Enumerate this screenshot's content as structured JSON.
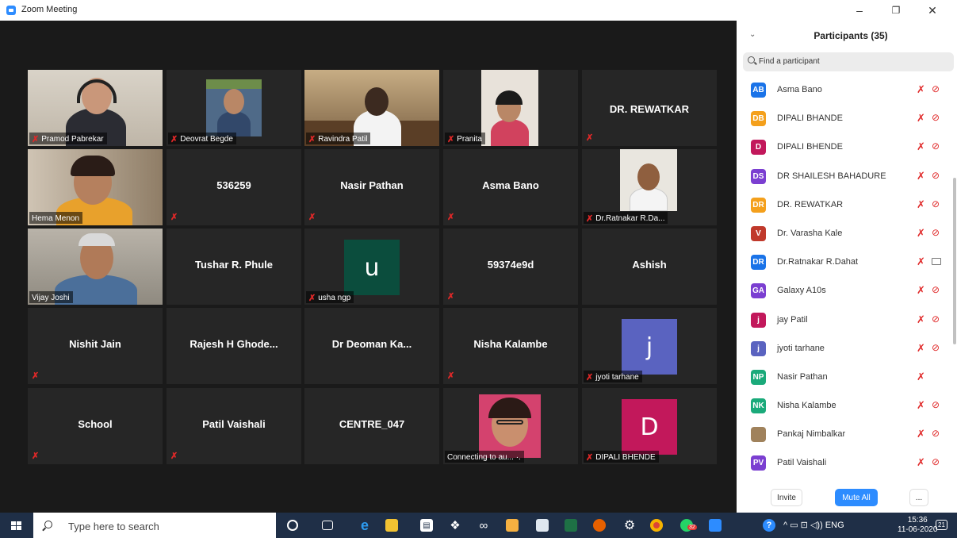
{
  "window": {
    "title": "Zoom Meeting",
    "minimize": "–",
    "restore": "❐",
    "close": "✕"
  },
  "gallery": {
    "mute_glyph": "✗",
    "tiles": [
      {
        "name": "Pramod Pabrekar",
        "type": "video"
      },
      {
        "name": "Deovrat Begde",
        "type": "video"
      },
      {
        "name": "Ravindra Patil",
        "type": "video"
      },
      {
        "name": "Pranita",
        "type": "video"
      },
      {
        "name": "DR. REWATKAR",
        "type": "name"
      },
      {
        "name": "Hema Menon",
        "type": "video",
        "active_speaker": true
      },
      {
        "name": "536259",
        "type": "name"
      },
      {
        "name": "Nasir Pathan",
        "type": "name"
      },
      {
        "name": "Asma Bano",
        "type": "name"
      },
      {
        "name": "Dr.Ratnakar R.Da...",
        "type": "video"
      },
      {
        "name": "Vijay Joshi",
        "type": "video"
      },
      {
        "name": "Tushar R. Phule",
        "type": "name"
      },
      {
        "name": "usha ngp",
        "type": "letter",
        "letter": "u",
        "color": "#0b4d3d"
      },
      {
        "name": "59374e9d",
        "type": "name"
      },
      {
        "name": "Ashish",
        "type": "name"
      },
      {
        "name": "Nishit Jain",
        "type": "name"
      },
      {
        "name": "Rajesh H Ghode...",
        "type": "name"
      },
      {
        "name": "Dr Deoman Ka...",
        "type": "name"
      },
      {
        "name": "Nisha Kalambe",
        "type": "name"
      },
      {
        "name": "jyoti tarhane",
        "type": "letter",
        "letter": "j",
        "color": "#5a63c0"
      },
      {
        "name": "School",
        "type": "name"
      },
      {
        "name": "Patil Vaishali",
        "type": "name"
      },
      {
        "name": "CENTRE_047",
        "type": "name"
      },
      {
        "name": "Connecting to au... ·.",
        "type": "video"
      },
      {
        "name": "DIPALI BHENDE",
        "type": "letter",
        "letter": "D",
        "color": "#c2185b"
      }
    ]
  },
  "participants": {
    "title": "Participants (35)",
    "search_placeholder": "Find a participant",
    "collapse_glyph": "⌄",
    "list": [
      {
        "initials": "AB",
        "name": "Asma Bano",
        "color": "#1a73e8",
        "mic": "off",
        "video": "off"
      },
      {
        "initials": "DB",
        "name": "DIPALI BHANDE",
        "color": "#f4a01c",
        "mic": "off",
        "video": "off"
      },
      {
        "initials": "D",
        "name": "DIPALI BHENDE",
        "color": "#c2185b",
        "mic": "off",
        "video": "off"
      },
      {
        "initials": "DS",
        "name": "DR SHAILESH BAHADURE",
        "color": "#7b3fd1",
        "mic": "off",
        "video": "off"
      },
      {
        "initials": "DR",
        "name": "DR. REWATKAR",
        "color": "#f4a01c",
        "mic": "off",
        "video": "off"
      },
      {
        "initials": "V",
        "name": "Dr. Varasha Kale",
        "color": "#c0392b",
        "mic": "off",
        "video": "off"
      },
      {
        "initials": "DR",
        "name": "Dr.Ratnakar R.Dahat",
        "color": "#1a73e8",
        "mic": "off",
        "video": "on"
      },
      {
        "initials": "GA",
        "name": "Galaxy A10s",
        "color": "#7b3fd1",
        "mic": "off",
        "video": "off"
      },
      {
        "initials": "j",
        "name": "jay Patil",
        "color": "#c2185b",
        "mic": "off",
        "video": "off"
      },
      {
        "initials": "j",
        "name": "jyoti tarhane",
        "color": "#5a63c0",
        "mic": "off",
        "video": "off"
      },
      {
        "initials": "NP",
        "name": "Nasir Pathan",
        "color": "#1aaa7a",
        "mic": "off",
        "video": "none"
      },
      {
        "initials": "NK",
        "name": "Nisha Kalambe",
        "color": "#1aaa7a",
        "mic": "off",
        "video": "off"
      },
      {
        "initials": "",
        "name": "Pankaj Nimbalkar",
        "color": "#a0825c",
        "mic": "off",
        "video": "off"
      },
      {
        "initials": "PV",
        "name": "Patil Vaishali",
        "color": "#7b3fd1",
        "mic": "off",
        "video": "off"
      }
    ],
    "invite_label": "Invite",
    "mute_all_label": "Mute All",
    "more_label": "..."
  },
  "taskbar": {
    "search_placeholder": "Type here to search",
    "tray_text": "^ ▭ ⊡ ◁)) ENG",
    "time": "15:36",
    "date": "11-06-2020",
    "notif_badge": "32",
    "action_center": "21"
  }
}
